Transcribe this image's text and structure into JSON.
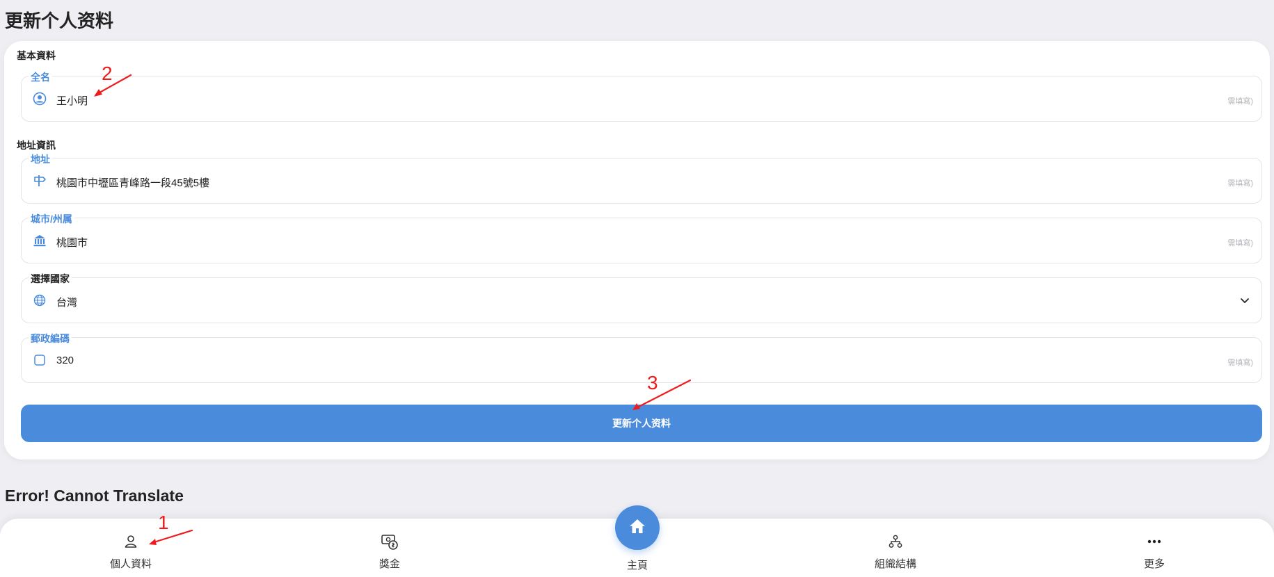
{
  "page": {
    "title": "更新个人资料",
    "section2_title": "Error! Cannot Translate"
  },
  "form": {
    "basic_section": "基本資料",
    "address_section": "地址資訊",
    "fields": [
      {
        "label": "全名",
        "value": "王小明",
        "hint": "需填寫)",
        "icon": "user-circle-icon"
      },
      {
        "label": "地址",
        "value": "桃園市中壢區青峰路一段45號5樓",
        "hint": "需填寫)",
        "icon": "signpost-icon"
      },
      {
        "label": "城市/州属",
        "value": "桃園市",
        "hint": "需填寫)",
        "icon": "bank-building-icon"
      },
      {
        "label": "選擇國家",
        "value": "台灣",
        "icon": "globe-icon"
      },
      {
        "label": "郵政編碼",
        "value": "320",
        "hint": "需填寫)",
        "icon": "square-icon"
      }
    ],
    "submit_label": "更新个人资料"
  },
  "nav": {
    "items": [
      {
        "label": "個人資料",
        "icon": "person-icon"
      },
      {
        "label": "獎金",
        "icon": "money-icon"
      },
      {
        "label": "主頁",
        "icon": "home-icon"
      },
      {
        "label": "組織結構",
        "icon": "org-chart-icon"
      },
      {
        "label": "更多",
        "icon": "more-dots-icon"
      }
    ]
  },
  "annotations": [
    "1",
    "2",
    "3"
  ],
  "colors": {
    "accent": "#4a8bdc",
    "background": "#eeeef3",
    "annotation": "#ee1c1c"
  }
}
